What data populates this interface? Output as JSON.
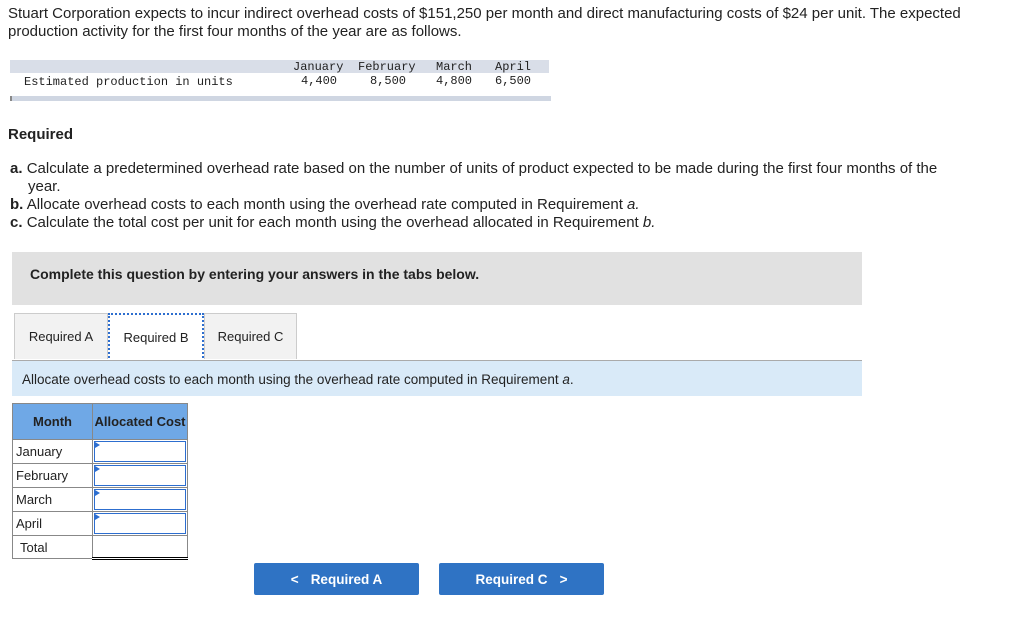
{
  "intro": "Stuart Corporation expects to incur indirect overhead costs of $151,250 per month and direct manufacturing costs of $24 per unit. The expected production activity for the first four months of the year are as follows.",
  "production": {
    "label": "Estimated production in units",
    "months": [
      "January",
      "February",
      "March",
      "April"
    ],
    "values": [
      "4,400",
      "8,500",
      "4,800",
      "6,500"
    ]
  },
  "required_heading": "Required",
  "requirements": [
    {
      "letter": "a.",
      "text": "Calculate a predetermined overhead rate based on the number of units of product expected to be made during the first four months of the year."
    },
    {
      "letter": "b.",
      "text": "Allocate overhead costs to each month using the overhead rate computed in Requirement ",
      "em": "a."
    },
    {
      "letter": "c.",
      "text": "Calculate the total cost per unit for each month using the overhead allocated in Requirement ",
      "em": "b."
    }
  ],
  "banner": "Complete this question by entering your answers in the tabs below.",
  "tabs": [
    "Required A",
    "Required B",
    "Required C"
  ],
  "active_tab": "Required B",
  "instruction": {
    "text": "Allocate overhead costs to each month using the overhead rate computed in Requirement ",
    "em": "a",
    "end": "."
  },
  "table": {
    "headers": [
      "Month",
      "Allocated Cost"
    ],
    "rows": [
      {
        "month": "January",
        "value": ""
      },
      {
        "month": "February",
        "value": ""
      },
      {
        "month": "March",
        "value": ""
      },
      {
        "month": "April",
        "value": ""
      }
    ],
    "total_label": "Total",
    "total_value": ""
  },
  "nav": {
    "prev": "Required A",
    "next": "Required C",
    "prev_icon": "chevron-left",
    "next_icon": "chevron-right"
  },
  "colors": {
    "accent": "#2f73c4",
    "header_blue": "#6fa8e6",
    "instruction_bg": "#d9eaf8"
  }
}
